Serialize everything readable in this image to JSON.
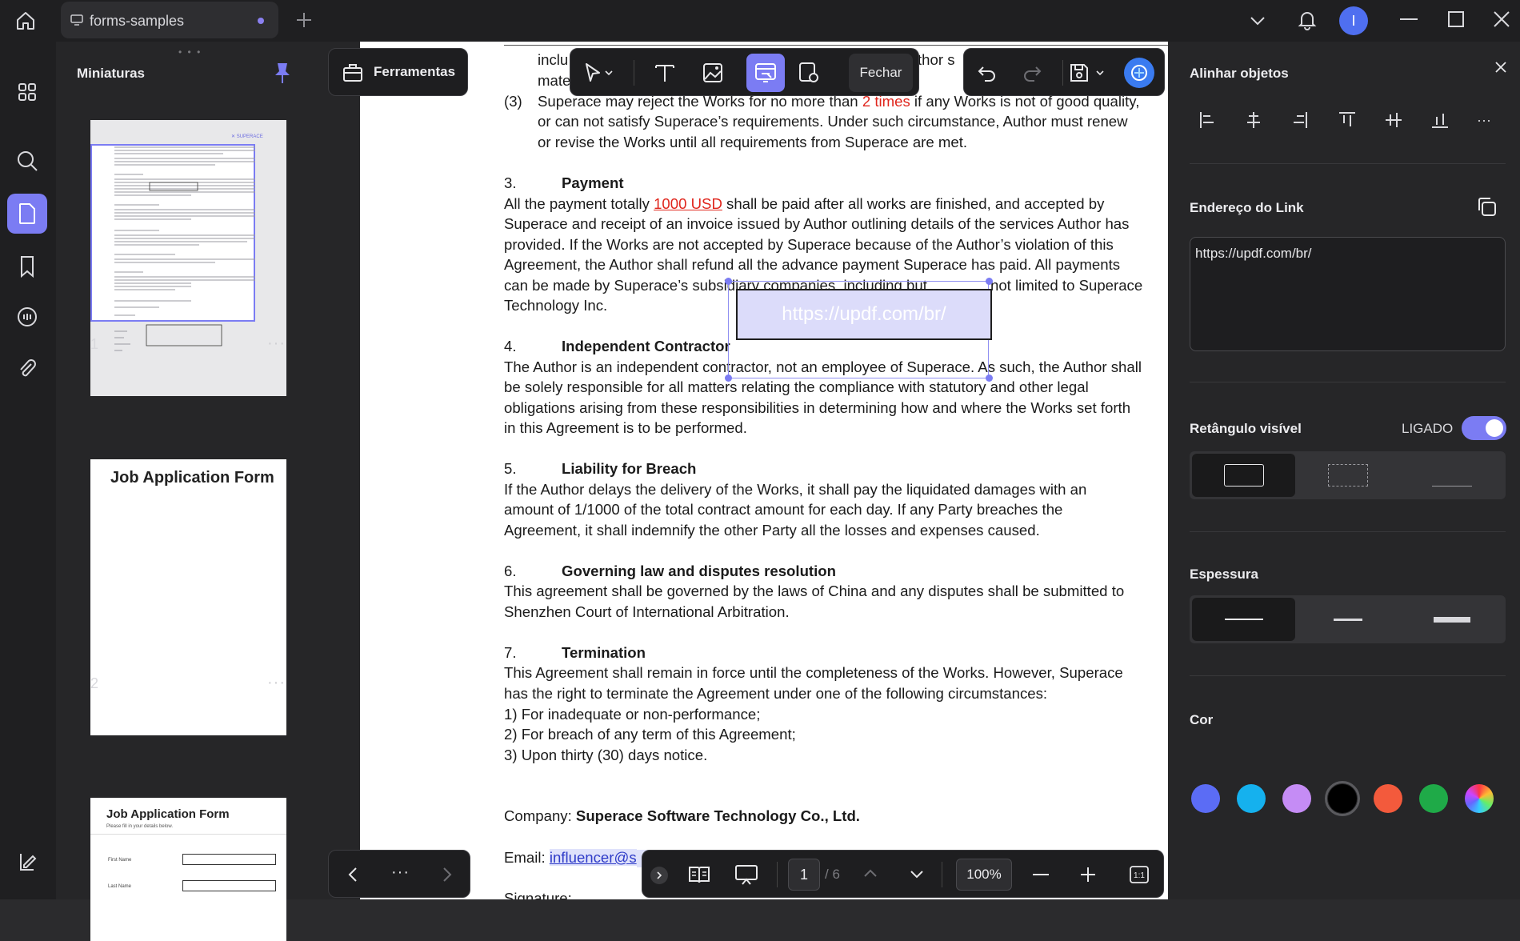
{
  "tab": {
    "title": "forms-samples"
  },
  "user": {
    "initial": "I"
  },
  "thumbnails": {
    "title": "Miniaturas",
    "pages": [
      {
        "number": "1",
        "more": "···"
      },
      {
        "number": "2",
        "more": "···",
        "heading": "Job Application Form"
      },
      {
        "heading": "Job Application Form",
        "subheading": "Please fill in your details below.",
        "first_name": "First Name",
        "last_name": "Last Name"
      }
    ]
  },
  "tools": {
    "label": "Ferramentas"
  },
  "edit_toolbar": {
    "close_label": "Fechar"
  },
  "document": {
    "lines": {
      "l0a": "inclu",
      "l0b": "thor s",
      "l1": "mate",
      "l2_num": "(3)",
      "l2a": "Superace may reject the Works for no more than ",
      "l2_red": "2 times",
      "l2b": " if any Works is not of good quality,",
      "l3": "or can not satisfy Superace’s requirements. Under such circumstance, Author must renew",
      "l4": "or revise the Works until all requirements from Superace are met.",
      "s3_num": "3.",
      "s3_title": "Payment",
      "p3_1a": "All the payment totally ",
      "p3_1red": "1000 USD",
      "p3_1b": " shall be paid after all works are finished, and accepted by",
      "p3_2": "Superace and receipt of an invoice issued by Author outlining details of the services Author has",
      "p3_3": "provided. If the Works are not accepted by Superace because of the Author’s violation of this",
      "p3_4": "Agreement, the Author shall refund all the advance payment Superace has paid. All payments",
      "p3_5a": "can be made by Superace’s subsidiary companies, including but",
      "p3_5b": "not limited to Superace",
      "p3_6": "Technology Inc.",
      "s4_num": "4.",
      "s4_title": "Independent Contractor",
      "p4_1": "The Author is an independent contractor, not an employee of Superace. As such, the Author shall",
      "p4_2": "be solely responsible for all matters relating the compliance with statutory and other legal",
      "p4_3": "obligations arising from these responsibilities in determining how and where the Works set forth",
      "p4_4": "in this Agreement is to be performed.",
      "s5_num": "5.",
      "s5_title": "Liability for Breach",
      "p5_1": "If the Author delays the delivery of the Works, it shall pay the liquidated damages with an",
      "p5_2": "amount of 1/1000 of the total contract amount for each day. If any Party breaches the",
      "p5_3": "Agreement, it shall indemnify the other Party all the losses and expenses caused.",
      "s6_num": "6.",
      "s6_title": "Governing law and disputes resolution",
      "p6_1": "This agreement shall be governed by the laws of China and any disputes shall be submitted to",
      "p6_2": "Shenzhen Court of International Arbitration.",
      "s7_num": "7.",
      "s7_title": "Termination",
      "p7_1": "This Agreement shall remain in force until the completeness of the Works. However, Superace",
      "p7_2": "has the right to terminate the Agreement under one of the following circumstances:",
      "p7_3": "1) For inadequate or non-performance;",
      "p7_4": "2) For breach of any term of this Agreement;",
      "p7_5": "3)  Upon thirty (30) days notice.",
      "company_label": "Company: ",
      "company_value": "Superace Software Technology Co., Ltd.",
      "email_label": "Email: ",
      "email_value": "influencer@s",
      "signature_label": "Signature:"
    },
    "link_box_text": "https://updf.com/br/"
  },
  "bottom_bar": {
    "page_current": "1",
    "page_total": "/ 6",
    "zoom": "100%"
  },
  "right_panel": {
    "align_title": "Alinhar objetos",
    "link_title": "Endereço do Link",
    "link_value": "https://updf.com/br/",
    "visible_rect_title": "Retângulo visível",
    "visible_rect_state": "LIGADO",
    "thickness_title": "Espessura",
    "color_title": "Cor",
    "colors": [
      "#5b6cf5",
      "#15b1ee",
      "#c58cf5",
      "#000000",
      "#f35a3c",
      "#1faa48"
    ],
    "selected_color": "#000000"
  },
  "colors": {
    "accent": "#7b7cf3",
    "link_blue": "#4d55e0",
    "red_text": "#e0261d"
  }
}
